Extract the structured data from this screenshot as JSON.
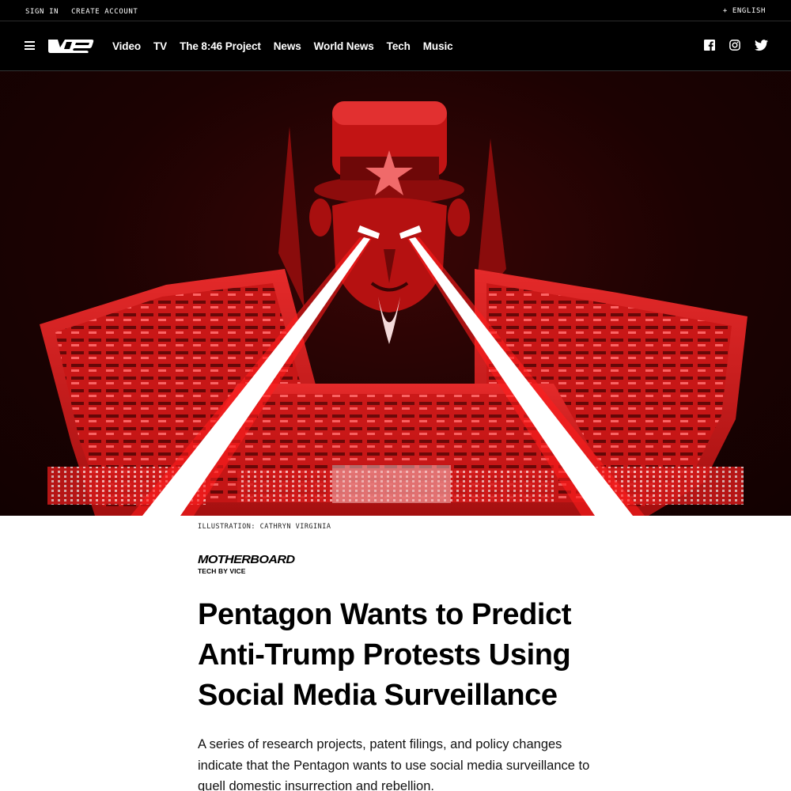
{
  "topbar": {
    "sign_in": "SIGN IN",
    "create_account": "CREATE ACCOUNT",
    "language": "+ ENGLISH"
  },
  "nav": {
    "logo_alt": "VICE",
    "menu_icon": "hamburger-menu-icon",
    "links": [
      "Video",
      "TV",
      "The 8:46 Project",
      "News",
      "World News",
      "Tech",
      "Music"
    ],
    "social_icons": [
      "facebook-icon",
      "instagram-icon",
      "twitter-icon"
    ]
  },
  "hero": {
    "colors": {
      "background": "#1c0202",
      "building": "#d61a1a",
      "beam": "#ffffff",
      "beam_glow": "#ff2020"
    }
  },
  "article": {
    "credit": "ILLUSTRATION: CATHRYN VIRGINIA",
    "brand_name": "MOTHERBOARD",
    "brand_tagline": "TECH BY VICE",
    "headline": "Pentagon Wants to Predict Anti-Trump Protests Using Social Media Surveillance",
    "dek": "A series of research projects, patent filings, and policy changes indicate that the Pentagon wants to use social media surveillance to quell domestic insurrection and rebellion."
  }
}
